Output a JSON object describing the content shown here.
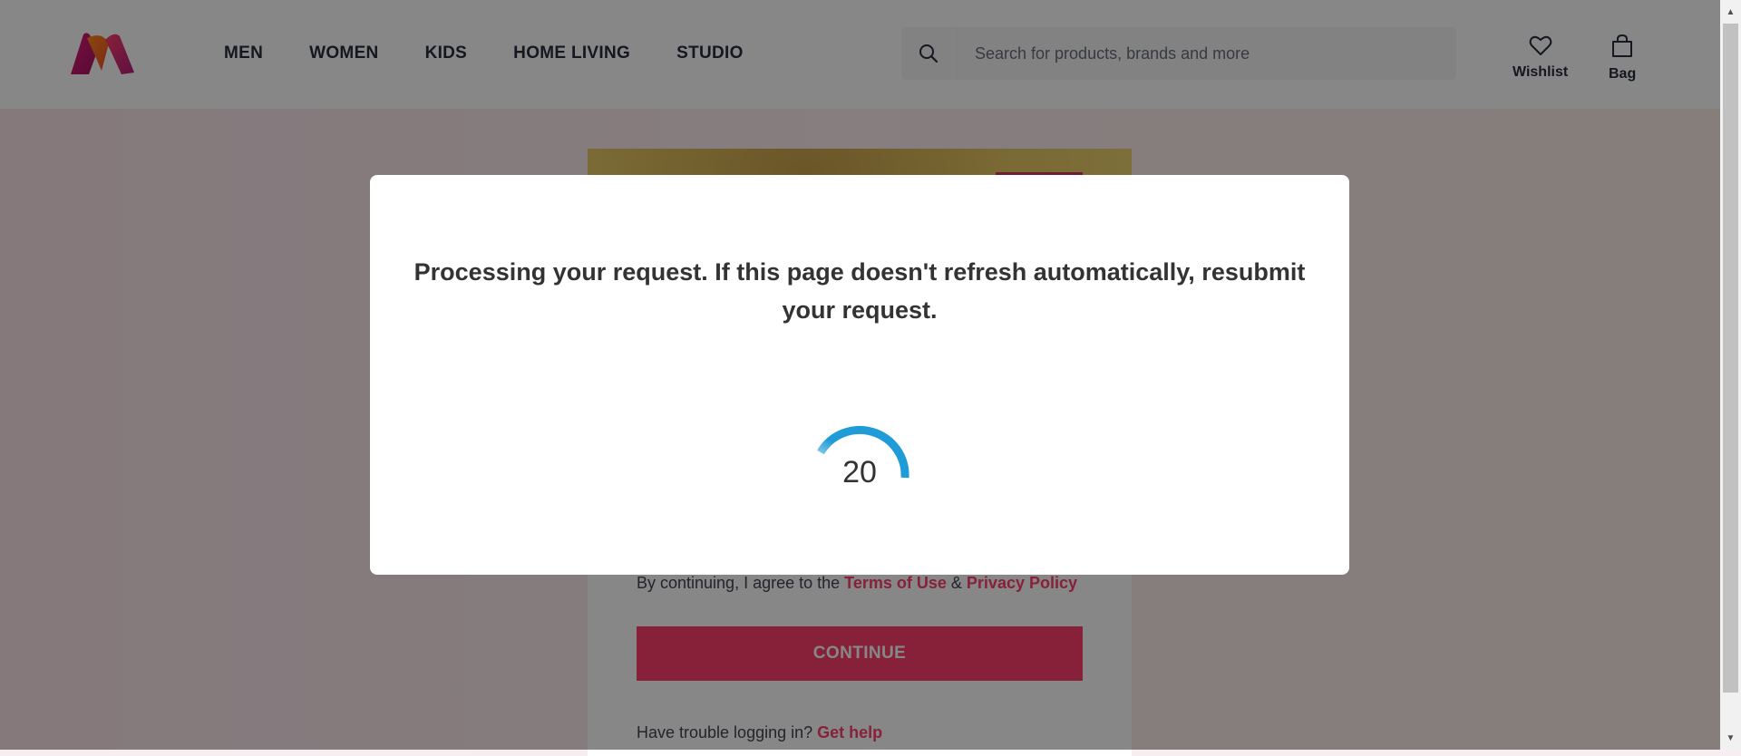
{
  "header": {
    "logo_alt": "Myntra logo",
    "nav": [
      "MEN",
      "WOMEN",
      "KIDS",
      "HOME LIVING",
      "STUDIO"
    ],
    "search": {
      "placeholder": "Search for products, brands and more",
      "icon": "search-icon"
    },
    "actions": [
      {
        "label": "Wishlist",
        "icon": "heart-icon"
      },
      {
        "label": "Bag",
        "icon": "bag-icon"
      }
    ]
  },
  "login": {
    "consent_prefix": "By continuing, I agree to the",
    "terms_link": "Terms of Use",
    "and": "&",
    "privacy_link": "Privacy Policy",
    "continue_label": "CONTINUE",
    "help_prefix": "Have trouble logging in?",
    "help_link": "Get help"
  },
  "modal": {
    "message": "Processing your request. If this page doesn't refresh automatically, resubmit your request.",
    "countdown": "20"
  },
  "colors": {
    "brand_pink": "#ff3f6c",
    "spinner_blue": "#1f9bd7",
    "overlay": "rgba(0,0,0,0.47)"
  }
}
